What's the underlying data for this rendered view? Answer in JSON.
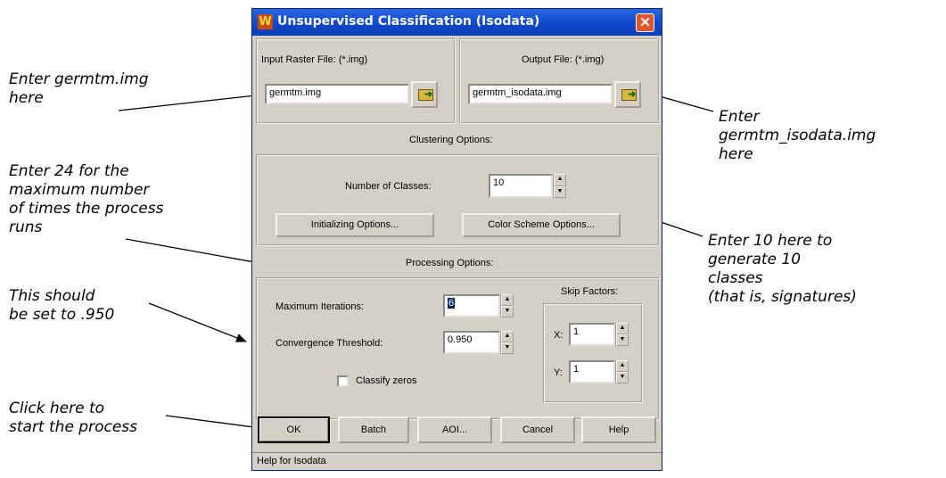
{
  "window": {
    "title": "Unsupervised Classification (Isodata)",
    "title_icon": "app-icon",
    "close_label": "✕"
  },
  "input_raster": {
    "label": "Input Raster File: (*.img)",
    "value": "germtm.img"
  },
  "output_file": {
    "label": "Output File: (*.img)",
    "value": "germtm_isodata.img"
  },
  "clustering": {
    "heading": "Clustering Options:",
    "num_classes_label": "Number of Classes:",
    "num_classes_value": "10",
    "initializing_button": "Initializing Options...",
    "color_scheme_button": "Color Scheme Options..."
  },
  "processing": {
    "heading": "Processing Options:",
    "max_iterations_label": "Maximum Iterations:",
    "max_iterations_value": "6",
    "convergence_label": "Convergence Threshold:",
    "convergence_value": "0.950",
    "classify_zeros_label": "Classify zeros",
    "classify_zeros_checked": false,
    "skip_factors_label": "Skip Factors:",
    "skip_x_label": "X:",
    "skip_x_value": "1",
    "skip_y_label": "Y:",
    "skip_y_value": "1"
  },
  "buttons": {
    "ok": "OK",
    "batch": "Batch",
    "aoi": "AOI...",
    "cancel": "Cancel",
    "help": "Help"
  },
  "status": "Help for Isodata",
  "annotations": {
    "input": "Enter germtm.img\nhere",
    "output": "Enter\ngermtm_isodata.img\nhere",
    "iterations": "Enter 24 for the\nmaximum number\nof times the process\nruns",
    "classes": "Enter 10 here to\ngenerate 10\nclasses\n(that is, signatures)",
    "convergence": "This should\nbe set to .950",
    "ok": "Click here to\nstart the process"
  }
}
